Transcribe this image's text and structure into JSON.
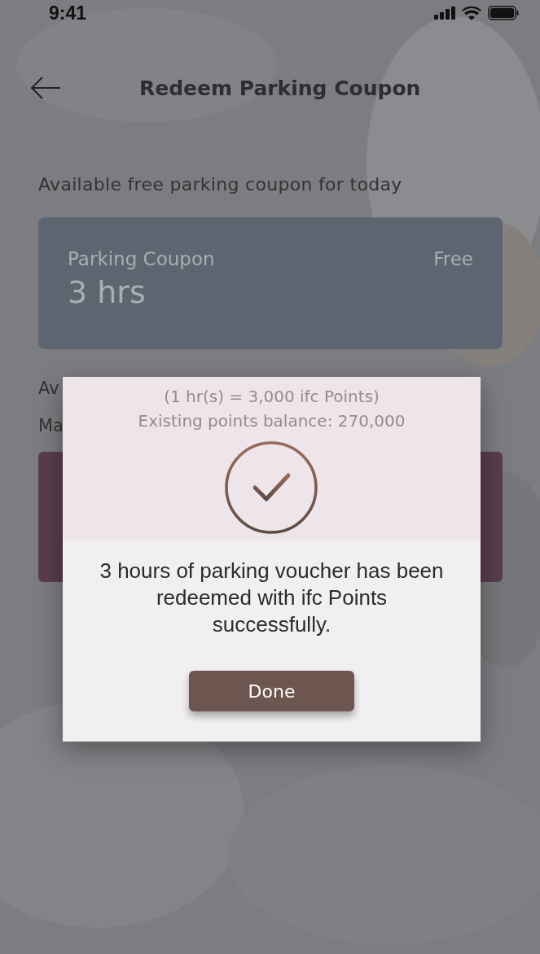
{
  "status_bar": {
    "time": "9:41"
  },
  "header": {
    "title": "Redeem Parking Coupon"
  },
  "section_label": "Available free parking coupon for today",
  "coupon": {
    "name": "Parking Coupon",
    "duration": "3 hrs",
    "price": "Free"
  },
  "hidden_lines": [
    "Av",
    "Ma"
  ],
  "modal": {
    "ghost_texts": [
      "(1 hr(s) = 3,000 ifc Points)",
      "Existing points balance: 270,000"
    ],
    "message": "3 hours of parking voucher has been redeemed with ifc Points successfully.",
    "button": "Done"
  }
}
